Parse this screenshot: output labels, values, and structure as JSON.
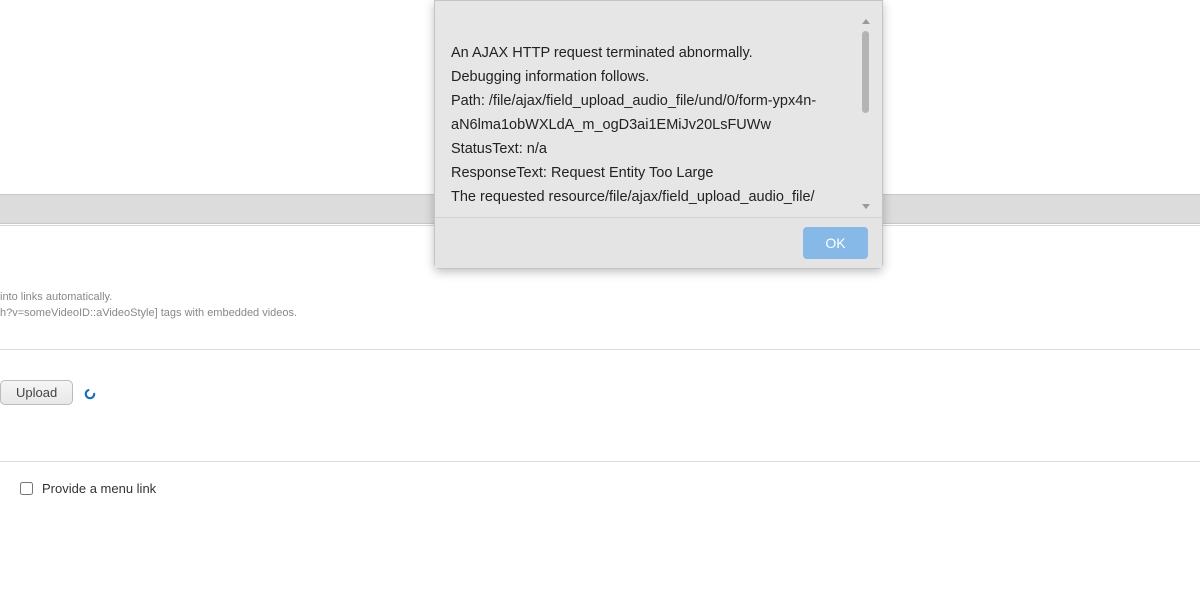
{
  "dialog": {
    "lines": [
      "An AJAX HTTP request terminated abnormally.",
      "Debugging information follows.",
      "Path: /file/ajax/field_upload_audio_file/und/0/form-ypx4n-aN6lma1obWXLdA_m_ogD3ai1EMiJv20LsFUWw",
      "StatusText: n/a",
      "ResponseText: Request Entity Too Large",
      "The requested resource/file/ajax/field_upload_audio_file/"
    ],
    "ok_label": "OK"
  },
  "hints": {
    "line1": " into links automatically.",
    "line2": "h?v=someVideoID::aVideoStyle] tags with embedded videos."
  },
  "upload": {
    "button_label": "Upload"
  },
  "menu": {
    "checkbox_label": "Provide a menu link",
    "checked": false
  }
}
